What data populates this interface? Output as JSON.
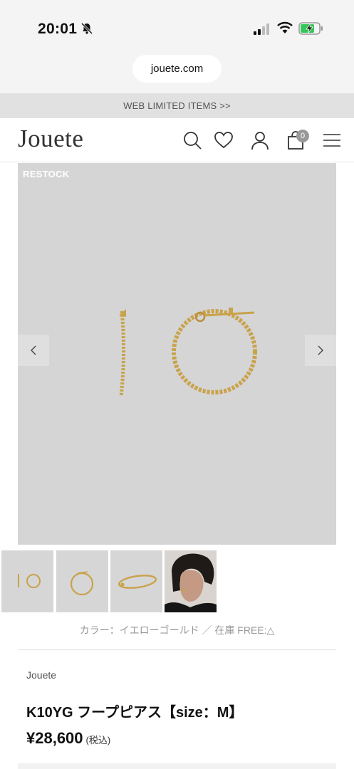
{
  "status_bar": {
    "time": "20:01"
  },
  "browser": {
    "url": "jouete.com"
  },
  "announcement": {
    "text": "WEB LIMITED ITEMS >>"
  },
  "header": {
    "logo": "Jouete",
    "icons": [
      "search-icon",
      "heart-icon",
      "user-icon",
      "bag-icon",
      "menu-icon"
    ],
    "cart_count": "0"
  },
  "gallery": {
    "badge": "RESTOCK",
    "thumbnails": [
      "thumb-hoop-pair",
      "thumb-hoop-single",
      "thumb-hoop-side",
      "thumb-model"
    ]
  },
  "product": {
    "color_line": "カラー：イエローゴールド ／ 在庫 FREE:△",
    "brand": "Jouete",
    "title": "K10YG フープピアス【size：M】",
    "price": "¥28,600",
    "tax_label": "(税込)"
  },
  "colors": {
    "gold": "#c9a24b",
    "image_bg": "#d5d5d5",
    "header_bg": "#f4f4f4"
  }
}
